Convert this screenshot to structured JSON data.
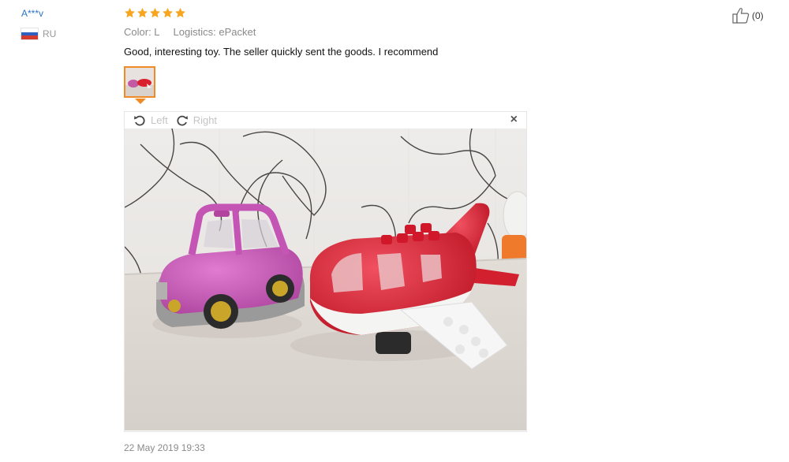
{
  "user": {
    "name": "A***v",
    "country": "RU"
  },
  "helpful": {
    "count_label": "(0)"
  },
  "review": {
    "rating": 5,
    "color_label": "Color: L",
    "logistics_label": "Logistics: ePacket",
    "text": "Good, interesting toy. The seller quickly sent the goods. I recommend",
    "date": "22 May 2019 19:33"
  },
  "viewer": {
    "rotate_left_label": "Left",
    "rotate_right_label": "Right",
    "close_symbol": "×"
  },
  "icons": {
    "star": "star-icon",
    "thumbs_up": "thumbs-up-icon",
    "rotate_left": "rotate-left-icon",
    "rotate_right": "rotate-right-icon",
    "close": "close-icon"
  },
  "colors": {
    "star": "#f6a623",
    "accent": "#f08a24",
    "link": "#2b74c7"
  }
}
